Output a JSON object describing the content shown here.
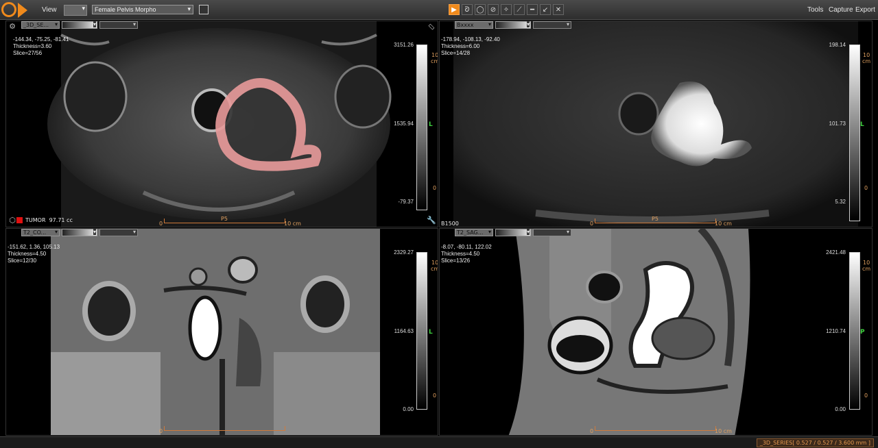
{
  "menu": {
    "view": "View",
    "protocol": "Female Pelvis Morpho",
    "tools": "Tools",
    "capture": "Capture",
    "export": "Export"
  },
  "toolbar": {
    "icons": [
      "pointer-icon",
      "lasso-icon",
      "ellipse-icon",
      "freehand-icon",
      "magic-wand-icon",
      "pen-icon",
      "line-measure-icon",
      "arrow-icon",
      "crosshair-icon"
    ],
    "glyphs": [
      "▶",
      "ᘐ",
      "◯",
      "⊘",
      "✧",
      "⟋",
      "━",
      "↙",
      "✕"
    ]
  },
  "viewports": {
    "tl": {
      "series": "_3D_SE...",
      "coords": "-144.34, -75.25, -81.41",
      "thickness": "Thickness=3.60",
      "slice": "Slice=27/56",
      "max": "3151.26",
      "mid": "1535.94",
      "min": "-79.37",
      "orient": "L",
      "ruler_label": "10 cm",
      "ruler_zero": "0",
      "ruler_marker": "P5",
      "cm_top": "10",
      "cm_unit": "cm",
      "cm_zero": "0",
      "legend_label": "TUMOR",
      "legend_value": "97.71 cc",
      "legend_color": "#e01010"
    },
    "tr": {
      "series": "Bxxxx",
      "coords": "-178.94, -108.13, -92.40",
      "thickness": "Thickness=6.00",
      "slice": "Slice=14/28",
      "max": "198.14",
      "mid": "101.73",
      "min": "5.32",
      "orient": "L",
      "ruler_label": "10 cm",
      "ruler_zero": "0",
      "ruler_marker": "P5",
      "cm_top": "10",
      "cm_unit": "cm",
      "cm_zero": "0",
      "bottom_label": "B1500"
    },
    "bl": {
      "series": "T2_CO...",
      "coords": "-151.62, 1.36, 105.13",
      "thickness": "Thickness=4.50",
      "slice": "Slice=12/30",
      "max": "2329.27",
      "mid": "1164.63",
      "min": "0.00",
      "orient": "L",
      "ruler_zero": "0",
      "cm_top": "10",
      "cm_unit": "cm",
      "cm_zero": "0"
    },
    "br": {
      "series": "T2_SAG...",
      "coords": "-8.07, -80.11, 122.02",
      "thickness": "Thickness=4.50",
      "slice": "Slice=13/26",
      "max": "2421.48",
      "mid": "1210.74",
      "min": "0.00",
      "orient": "P",
      "ruler_label": "10 cm",
      "ruler_zero": "0",
      "cm_top": "10",
      "cm_unit": "cm",
      "cm_zero": "0"
    }
  },
  "status": "_3D_SERIES[ 0.527 / 0.527 / 3.600 mm ]"
}
